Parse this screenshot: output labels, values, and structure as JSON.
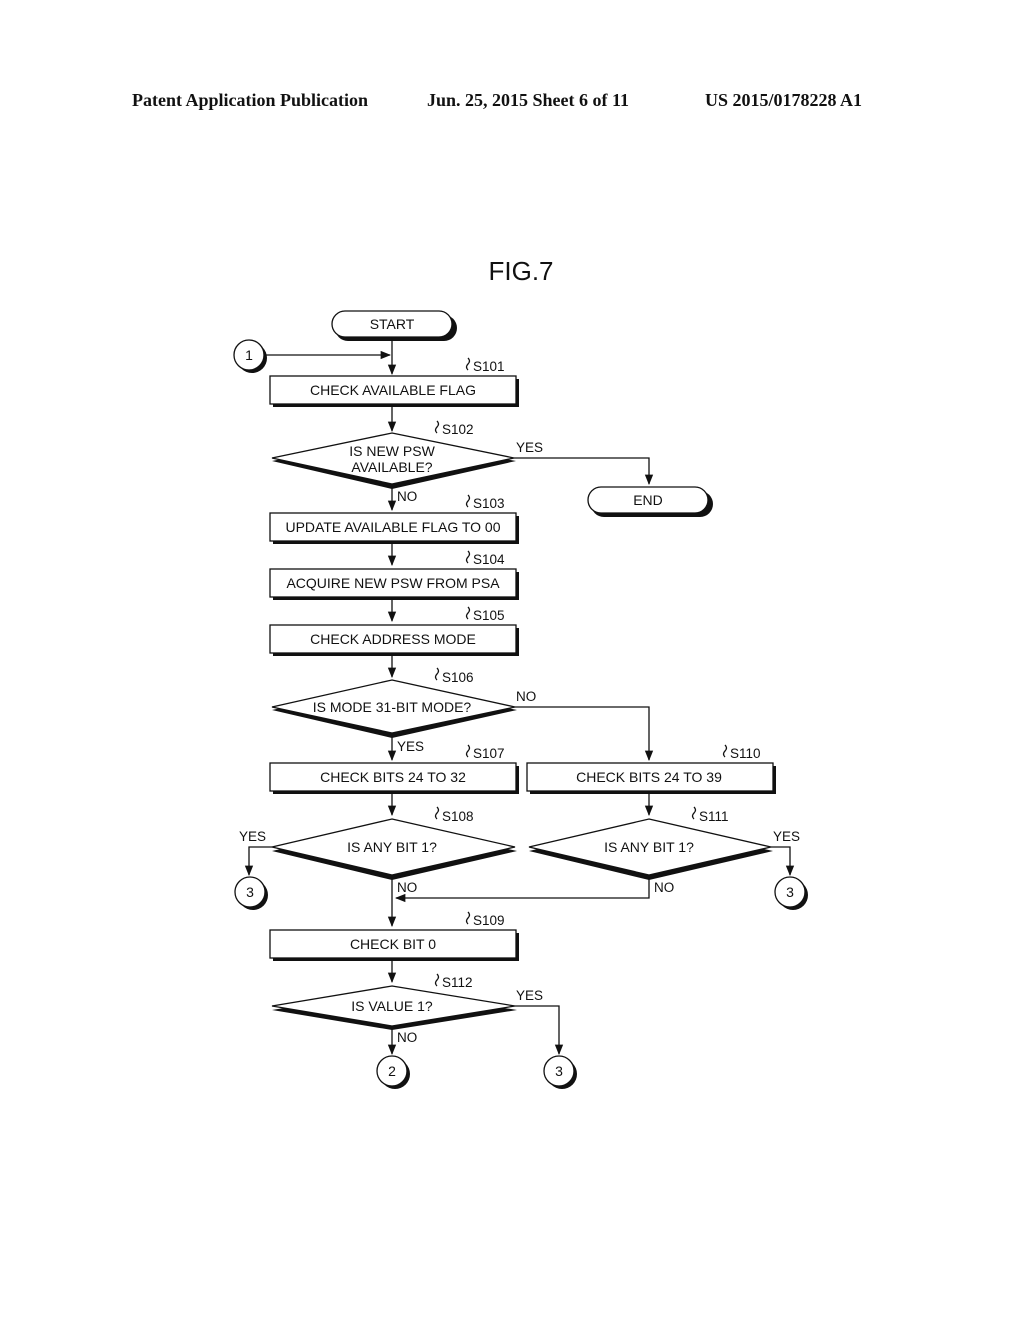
{
  "header": {
    "left": "Patent Application Publication",
    "middle": "Jun. 25, 2015  Sheet 6 of 11",
    "right": "US 2015/0178228 A1"
  },
  "figure": {
    "title": "FIG.7",
    "terminals": {
      "start": "START",
      "end": "END"
    },
    "connectors": {
      "entry": "1",
      "no_exit": "2",
      "yes_exit_left": "3",
      "yes_exit_right": "3",
      "yes_exit_bottom": "3"
    },
    "steps": {
      "s101": {
        "id": "S101",
        "text": "CHECK AVAILABLE FLAG"
      },
      "s102": {
        "id": "S102",
        "line1": "IS NEW PSW",
        "line2": "AVAILABLE?"
      },
      "s103": {
        "id": "S103",
        "text": "UPDATE AVAILABLE FLAG TO 00"
      },
      "s104": {
        "id": "S104",
        "text": "ACQUIRE NEW PSW FROM PSA"
      },
      "s105": {
        "id": "S105",
        "text": "CHECK ADDRESS MODE"
      },
      "s106": {
        "id": "S106",
        "text": "IS MODE 31-BIT MODE?"
      },
      "s107": {
        "id": "S107",
        "text": "CHECK BITS 24 TO 32"
      },
      "s108": {
        "id": "S108",
        "text": "IS ANY BIT 1?"
      },
      "s109": {
        "id": "S109",
        "text": "CHECK BIT 0"
      },
      "s110": {
        "id": "S110",
        "text": "CHECK BITS 24 TO 39"
      },
      "s111": {
        "id": "S111",
        "text": "IS ANY BIT 1?"
      },
      "s112": {
        "id": "S112",
        "text": "IS VALUE 1?"
      }
    },
    "edge_labels": {
      "yes": "YES",
      "no": "NO"
    }
  }
}
